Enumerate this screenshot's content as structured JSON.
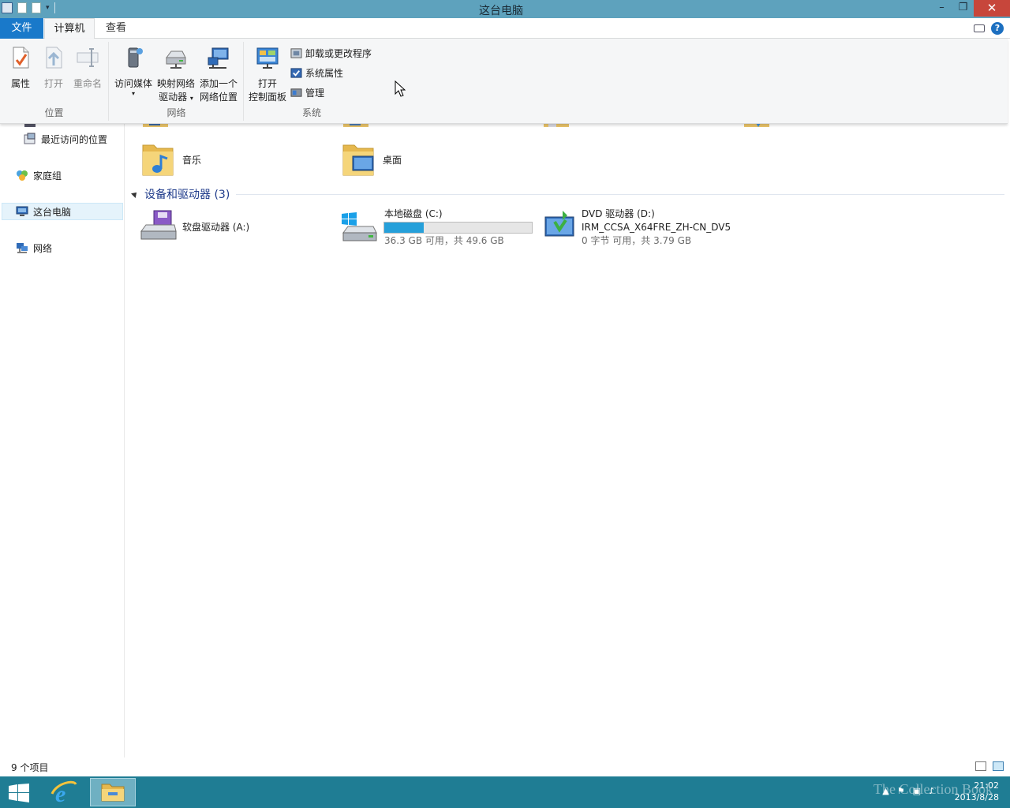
{
  "window": {
    "title": "这台电脑",
    "minimize": "–",
    "maximize": "❐",
    "close": "✕"
  },
  "ribbon": {
    "tabs": [
      {
        "label": "文件"
      },
      {
        "label": "计算机"
      },
      {
        "label": "查看"
      }
    ],
    "help": "?",
    "groups": {
      "location": {
        "label": "位置",
        "properties": "属性",
        "open": "打开",
        "rename": "重命名"
      },
      "network": {
        "label": "网络",
        "access_media": "访问媒体",
        "map_drive_line1": "映射网络",
        "map_drive_line2": "驱动器",
        "add_location_line1": "添加一个",
        "add_location_line2": "网络位置"
      },
      "system": {
        "label": "系统",
        "open_cp_line1": "打开",
        "open_cp_line2": "控制面板",
        "uninstall": "卸载或更改程序",
        "system_properties": "系统属性",
        "manage": "管理"
      }
    }
  },
  "nav": {
    "partial_item": "…",
    "recent": "最近访问的位置",
    "homegroup": "家庭组",
    "this_pc": "这台电脑",
    "network": "网络"
  },
  "content": {
    "folders": [
      {
        "label": "音乐"
      },
      {
        "label": "桌面"
      }
    ],
    "devices_header": "设备和驱动器 (3)",
    "drives": {
      "floppy": {
        "label": "软盘驱动器 (A:)"
      },
      "local": {
        "label": "本地磁盘 (C:)",
        "detail": "36.3 GB 可用，共 49.6 GB",
        "used_fraction": 0.27
      },
      "dvd": {
        "label": "DVD 驱动器 (D:)",
        "volume": "IRM_CCSA_X64FRE_ZH-CN_DV5",
        "detail": "0 字节 可用，共 3.79 GB"
      }
    }
  },
  "status": {
    "count": "9 个项目"
  },
  "taskbar": {
    "time": "21:02",
    "date": "2013/8/28",
    "watermark": "The Collection Book"
  },
  "colors": {
    "titlebar": "#5ea2bd",
    "file_tab": "#1979ca",
    "taskbar": "#1f7d94",
    "drive_bar": "#26a0da"
  }
}
